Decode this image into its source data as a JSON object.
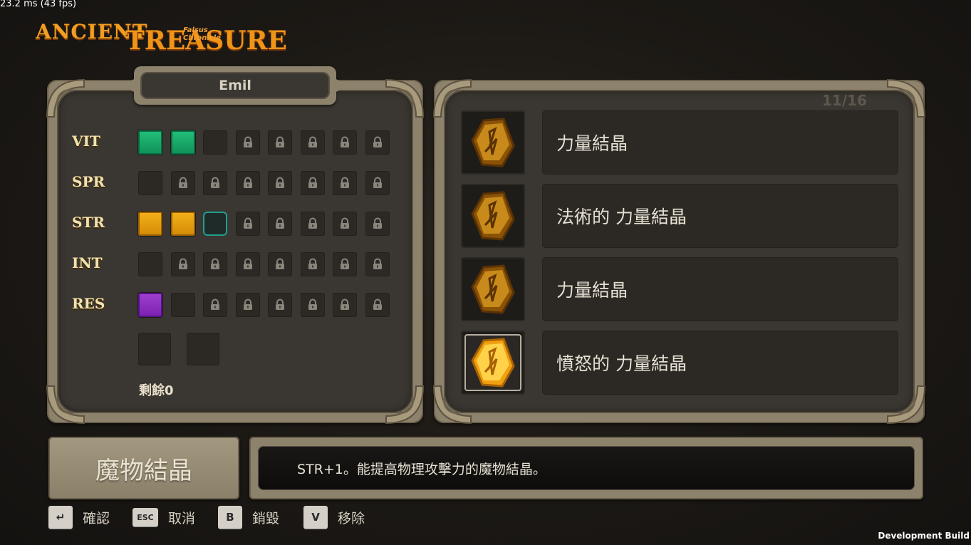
{
  "debug": {
    "fps_text": "23.2 ms (43 fps)",
    "build_text": "Development Build"
  },
  "logo": {
    "word1": "ANCIENT",
    "word2": "TREASURE",
    "subtitle": "Falsus Chronicle"
  },
  "character": {
    "name": "Emil"
  },
  "stats": [
    {
      "label": "VIT",
      "slots": [
        "green",
        "green",
        "empty",
        "locked",
        "locked",
        "locked",
        "locked",
        "locked"
      ]
    },
    {
      "label": "SPR",
      "slots": [
        "empty",
        "locked",
        "locked",
        "locked",
        "locked",
        "locked",
        "locked",
        "locked"
      ]
    },
    {
      "label": "STR",
      "slots": [
        "yellow",
        "yellow",
        "selected",
        "locked",
        "locked",
        "locked",
        "locked",
        "locked"
      ]
    },
    {
      "label": "INT",
      "slots": [
        "empty",
        "locked",
        "locked",
        "locked",
        "locked",
        "locked",
        "locked",
        "locked"
      ]
    },
    {
      "label": "RES",
      "slots": [
        "purple",
        "empty",
        "locked",
        "locked",
        "locked",
        "locked",
        "locked",
        "locked"
      ]
    }
  ],
  "remaining": {
    "label": "剩餘0"
  },
  "item_list": {
    "page": "11/16",
    "items": [
      {
        "name": "力量結晶",
        "icon": "amber-crystal-icon",
        "highlight": false
      },
      {
        "name": "法術的 力量結晶",
        "icon": "amber-crystal-icon",
        "highlight": false
      },
      {
        "name": "力量結晶",
        "icon": "amber-crystal-icon",
        "highlight": false
      },
      {
        "name": "憤怒的 力量結晶",
        "icon": "amber-crystal-icon",
        "highlight": true
      }
    ]
  },
  "detail": {
    "title": "魔物結晶",
    "description": "STR+1。能提高物理攻擊力的魔物結晶。"
  },
  "controls": [
    {
      "key": "↵",
      "label": "確認",
      "key_icon": "enter-key-icon"
    },
    {
      "key": "ESC",
      "label": "取消",
      "key_icon": "esc-key-icon"
    },
    {
      "key": "B",
      "label": "銷毀",
      "key_icon": "b-key-icon"
    },
    {
      "key": "V",
      "label": "移除",
      "key_icon": "v-key-icon"
    }
  ],
  "colors": {
    "green": "#22c07a",
    "yellow": "#f4b21a",
    "purple": "#a040d0",
    "selected_outline": "#21a08a",
    "frame": "#8d826b"
  }
}
